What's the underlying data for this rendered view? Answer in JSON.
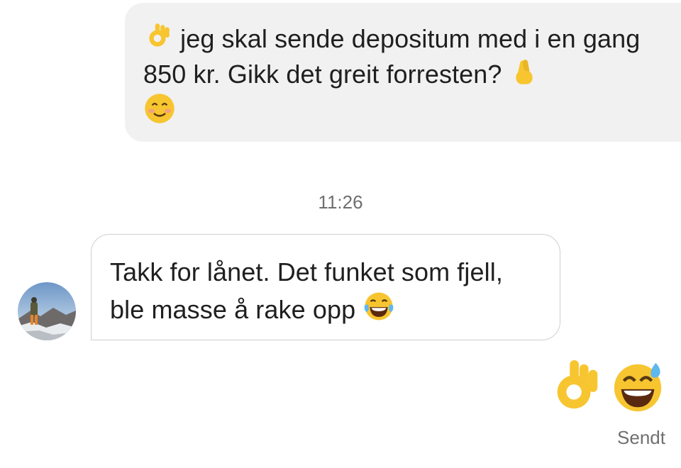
{
  "conversation": {
    "outgoing_message": {
      "text_part1": "jeg skal sende depositum med i en gang 850 kr. Gikk det greit forresten?",
      "emojis": [
        "ok-hand-icon",
        "crossed-fingers-icon",
        "smiling-face-icon"
      ]
    },
    "timestamp": "11:26",
    "incoming_message": {
      "text": "Takk for lånet. Det funket som fjell, ble masse å rake opp",
      "emojis": [
        "tears-of-joy-icon"
      ],
      "avatar": "user-avatar"
    },
    "outgoing_emoji_message": {
      "emojis": [
        "ok-hand-icon",
        "grinning-sweat-icon"
      ]
    },
    "delivery_status": "Sendt"
  },
  "colors": {
    "outgoing_bubble": "#f1f1f1",
    "incoming_border": "#cfcfcf",
    "meta_text": "#6f6f6f",
    "emoji_yellow": "#f7c530"
  }
}
